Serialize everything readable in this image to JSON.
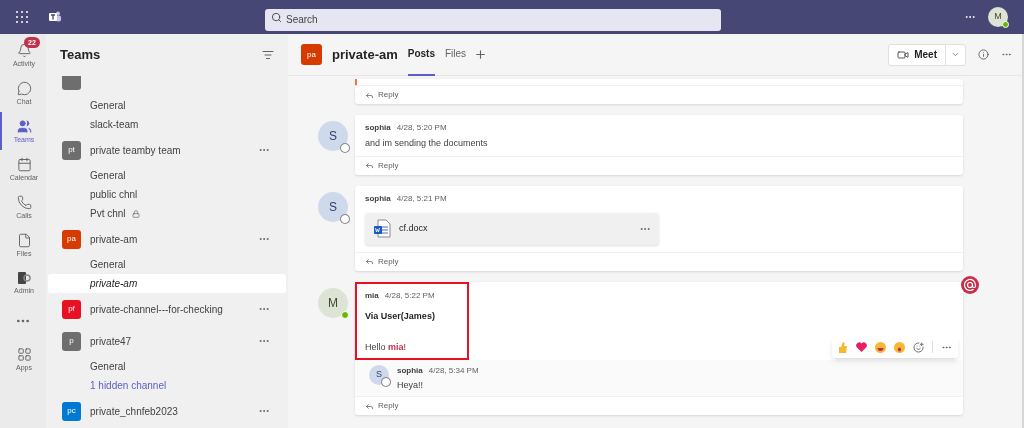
{
  "top_bar": {
    "search": {
      "placeholder": "Search"
    },
    "user": {
      "initials": "M",
      "available": true
    }
  },
  "rail": [
    {
      "kind": "activity",
      "label": "Activity",
      "badge": "22",
      "selected": false
    },
    {
      "kind": "chat",
      "label": "Chat",
      "selected": false
    },
    {
      "kind": "teams",
      "label": "Teams",
      "selected": true
    },
    {
      "kind": "calendar",
      "label": "Calendar",
      "selected": false
    },
    {
      "kind": "calls",
      "label": "Calls",
      "selected": false
    },
    {
      "kind": "files",
      "label": "Files",
      "selected": false
    },
    {
      "kind": "admin",
      "label": "Admin",
      "selected": false
    },
    {
      "kind": "more"
    },
    {
      "kind": "apps",
      "label": "Apps",
      "selected": false
    }
  ],
  "teams_panel": {
    "title": "Teams",
    "teams": [
      {
        "color": "#6e6e6e",
        "channels": [
          {
            "name": "General",
            "kind": "channel",
            "selected": false
          },
          {
            "name": "slack-team",
            "kind": "channel",
            "selected": false
          }
        ]
      },
      {
        "initials": "pt",
        "name": "private teamby team",
        "color": "#6e6e6e",
        "channels": [
          {
            "name": "General",
            "kind": "channel",
            "selected": false
          },
          {
            "name": "public chnl",
            "kind": "channel",
            "selected": false
          },
          {
            "name": "Pvt chnl",
            "kind": "private",
            "selected": false
          }
        ]
      },
      {
        "initials": "pa",
        "name": "private-am",
        "color": "#d83b01",
        "channels": [
          {
            "name": "General",
            "kind": "channel",
            "selected": false
          },
          {
            "name": "private-am",
            "kind": "channel",
            "selected": true
          }
        ]
      },
      {
        "initials": "pf",
        "name": "private-channel---for-checking",
        "color": "#e81123"
      },
      {
        "initials": "p",
        "name": "private47",
        "color": "#6e6e6e",
        "channels": [
          {
            "name": "General",
            "kind": "channel",
            "selected": false
          },
          {
            "name": "1 hidden channel",
            "kind": "link",
            "selected": false
          }
        ]
      },
      {
        "initials": "pc",
        "name": "private_chnfeb2023",
        "color": "#0078d4"
      }
    ]
  },
  "channel_header": {
    "initials": "pa",
    "color": "#d83b01",
    "name": "private-am",
    "tabs": [
      {
        "label": "Posts",
        "selected": true
      },
      {
        "label": "Files",
        "selected": false
      }
    ],
    "meet": "Meet"
  },
  "posts": [
    {
      "kind": "cut",
      "reply_label": "Reply"
    },
    {
      "kind": "text",
      "initials": "S",
      "author": "sophia",
      "available": false,
      "time": "4/28, 5:20 PM",
      "text": "and im sending the documents",
      "reply_label": "Reply"
    },
    {
      "kind": "file",
      "initials": "S",
      "author": "sophia",
      "available": false,
      "time": "4/28, 5:21 PM",
      "file": "cf.docx",
      "reply_label": "Reply"
    },
    {
      "kind": "text",
      "initials": "M",
      "author": "mia",
      "available": true,
      "time": "4/28, 5:22 PM",
      "subject": "Via User(James)",
      "text": "Hello **mia**!",
      "highlighted": true,
      "mentioned": true,
      "reply_label": "Reply",
      "replies": [
        {
          "initials": "S",
          "author": "sophia",
          "available": false,
          "time": "4/28, 5:34 PM",
          "text": "Heya!!"
        }
      ]
    }
  ]
}
